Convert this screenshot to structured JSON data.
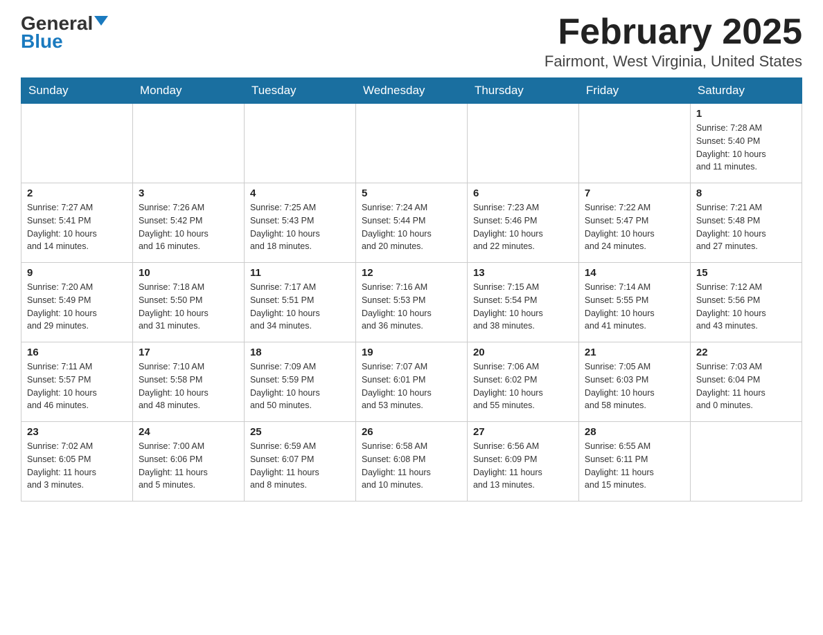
{
  "header": {
    "logo_general": "General",
    "logo_blue": "Blue",
    "month_title": "February 2025",
    "location": "Fairmont, West Virginia, United States"
  },
  "days_of_week": [
    "Sunday",
    "Monday",
    "Tuesday",
    "Wednesday",
    "Thursday",
    "Friday",
    "Saturday"
  ],
  "weeks": [
    {
      "days": [
        {
          "num": "",
          "info": ""
        },
        {
          "num": "",
          "info": ""
        },
        {
          "num": "",
          "info": ""
        },
        {
          "num": "",
          "info": ""
        },
        {
          "num": "",
          "info": ""
        },
        {
          "num": "",
          "info": ""
        },
        {
          "num": "1",
          "info": "Sunrise: 7:28 AM\nSunset: 5:40 PM\nDaylight: 10 hours\nand 11 minutes."
        }
      ]
    },
    {
      "days": [
        {
          "num": "2",
          "info": "Sunrise: 7:27 AM\nSunset: 5:41 PM\nDaylight: 10 hours\nand 14 minutes."
        },
        {
          "num": "3",
          "info": "Sunrise: 7:26 AM\nSunset: 5:42 PM\nDaylight: 10 hours\nand 16 minutes."
        },
        {
          "num": "4",
          "info": "Sunrise: 7:25 AM\nSunset: 5:43 PM\nDaylight: 10 hours\nand 18 minutes."
        },
        {
          "num": "5",
          "info": "Sunrise: 7:24 AM\nSunset: 5:44 PM\nDaylight: 10 hours\nand 20 minutes."
        },
        {
          "num": "6",
          "info": "Sunrise: 7:23 AM\nSunset: 5:46 PM\nDaylight: 10 hours\nand 22 minutes."
        },
        {
          "num": "7",
          "info": "Sunrise: 7:22 AM\nSunset: 5:47 PM\nDaylight: 10 hours\nand 24 minutes."
        },
        {
          "num": "8",
          "info": "Sunrise: 7:21 AM\nSunset: 5:48 PM\nDaylight: 10 hours\nand 27 minutes."
        }
      ]
    },
    {
      "days": [
        {
          "num": "9",
          "info": "Sunrise: 7:20 AM\nSunset: 5:49 PM\nDaylight: 10 hours\nand 29 minutes."
        },
        {
          "num": "10",
          "info": "Sunrise: 7:18 AM\nSunset: 5:50 PM\nDaylight: 10 hours\nand 31 minutes."
        },
        {
          "num": "11",
          "info": "Sunrise: 7:17 AM\nSunset: 5:51 PM\nDaylight: 10 hours\nand 34 minutes."
        },
        {
          "num": "12",
          "info": "Sunrise: 7:16 AM\nSunset: 5:53 PM\nDaylight: 10 hours\nand 36 minutes."
        },
        {
          "num": "13",
          "info": "Sunrise: 7:15 AM\nSunset: 5:54 PM\nDaylight: 10 hours\nand 38 minutes."
        },
        {
          "num": "14",
          "info": "Sunrise: 7:14 AM\nSunset: 5:55 PM\nDaylight: 10 hours\nand 41 minutes."
        },
        {
          "num": "15",
          "info": "Sunrise: 7:12 AM\nSunset: 5:56 PM\nDaylight: 10 hours\nand 43 minutes."
        }
      ]
    },
    {
      "days": [
        {
          "num": "16",
          "info": "Sunrise: 7:11 AM\nSunset: 5:57 PM\nDaylight: 10 hours\nand 46 minutes."
        },
        {
          "num": "17",
          "info": "Sunrise: 7:10 AM\nSunset: 5:58 PM\nDaylight: 10 hours\nand 48 minutes."
        },
        {
          "num": "18",
          "info": "Sunrise: 7:09 AM\nSunset: 5:59 PM\nDaylight: 10 hours\nand 50 minutes."
        },
        {
          "num": "19",
          "info": "Sunrise: 7:07 AM\nSunset: 6:01 PM\nDaylight: 10 hours\nand 53 minutes."
        },
        {
          "num": "20",
          "info": "Sunrise: 7:06 AM\nSunset: 6:02 PM\nDaylight: 10 hours\nand 55 minutes."
        },
        {
          "num": "21",
          "info": "Sunrise: 7:05 AM\nSunset: 6:03 PM\nDaylight: 10 hours\nand 58 minutes."
        },
        {
          "num": "22",
          "info": "Sunrise: 7:03 AM\nSunset: 6:04 PM\nDaylight: 11 hours\nand 0 minutes."
        }
      ]
    },
    {
      "days": [
        {
          "num": "23",
          "info": "Sunrise: 7:02 AM\nSunset: 6:05 PM\nDaylight: 11 hours\nand 3 minutes."
        },
        {
          "num": "24",
          "info": "Sunrise: 7:00 AM\nSunset: 6:06 PM\nDaylight: 11 hours\nand 5 minutes."
        },
        {
          "num": "25",
          "info": "Sunrise: 6:59 AM\nSunset: 6:07 PM\nDaylight: 11 hours\nand 8 minutes."
        },
        {
          "num": "26",
          "info": "Sunrise: 6:58 AM\nSunset: 6:08 PM\nDaylight: 11 hours\nand 10 minutes."
        },
        {
          "num": "27",
          "info": "Sunrise: 6:56 AM\nSunset: 6:09 PM\nDaylight: 11 hours\nand 13 minutes."
        },
        {
          "num": "28",
          "info": "Sunrise: 6:55 AM\nSunset: 6:11 PM\nDaylight: 11 hours\nand 15 minutes."
        },
        {
          "num": "",
          "info": ""
        }
      ]
    }
  ]
}
